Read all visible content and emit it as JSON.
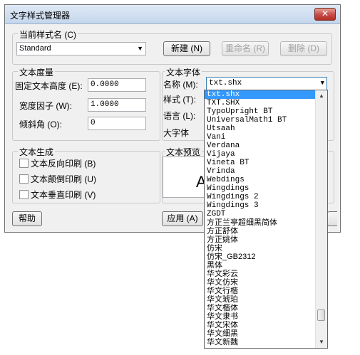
{
  "window": {
    "title": "文字样式管理器",
    "close_glyph": "✕"
  },
  "current_style": {
    "group_label": "当前样式名 (C)",
    "value": "Standard",
    "new_button": "新建 (N)",
    "rename_button": "重命名 (R)",
    "delete_button": "删除 (D)"
  },
  "metrics": {
    "group_label": "文本度量",
    "fixed_height_label": "固定文本高度 (E):",
    "fixed_height_value": "0.0000",
    "width_factor_label": "宽度因子 (W):",
    "width_factor_value": "1.0000",
    "oblique_label": "倾斜角 (O):",
    "oblique_value": "0"
  },
  "font": {
    "group_label": "文本字体",
    "name_label": "名称 (M):",
    "name_value": "txt.shx",
    "style_label": "样式 (T):",
    "language_label": "语言 (L):",
    "bigfont_label": "大字体"
  },
  "generation": {
    "group_label": "文本生成",
    "backward": "文本反向印刷 (B)",
    "upside_down": "文本颠倒印刷 (U)",
    "vertical": "文本垂直印刷 (V)"
  },
  "preview": {
    "group_label": "文本预览",
    "preview_char": "A"
  },
  "buttons": {
    "help": "帮助",
    "apply": "应用 (A)"
  },
  "font_list": {
    "selected_index": 0,
    "items": [
      "txt.shx",
      "TXT.SHX",
      "TypoUpright BT",
      "UniversalMath1 BT",
      "Utsaah",
      "Vani",
      "Verdana",
      "Vijaya",
      "Vineta BT",
      "Vrinda",
      "Webdings",
      "Wingdings",
      "Wingdings 2",
      "Wingdings 3",
      "ZGDT",
      "方正兰亭超细黑简体",
      "方正舒体",
      "方正姚体",
      "仿宋",
      "仿宋_GB2312",
      "黑体",
      "华文彩云",
      "华文仿宋",
      "华文行楷",
      "华文琥珀",
      "华文楷体",
      "华文隶书",
      "华文宋体",
      "华文细黑",
      "华文新魏"
    ]
  }
}
